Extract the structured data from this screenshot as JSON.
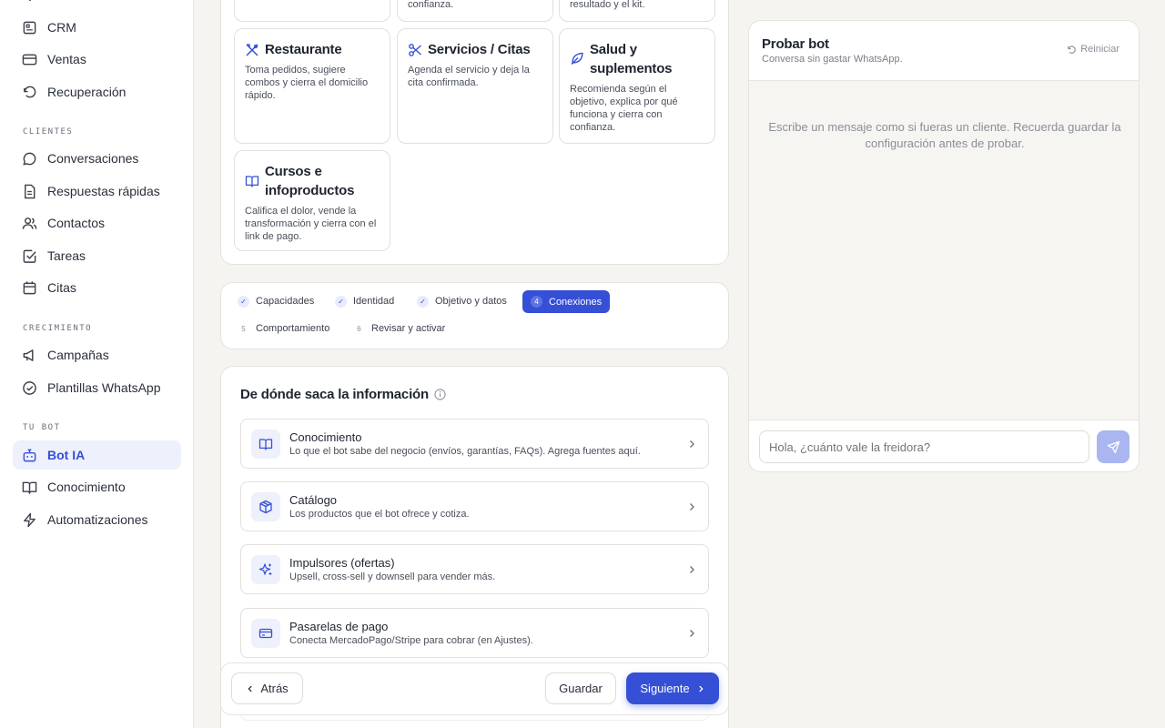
{
  "sidebar": {
    "items_top": [
      {
        "label": "CRM",
        "icon": "crm-icon"
      },
      {
        "label": "Ventas",
        "icon": "credit-card-icon"
      },
      {
        "label": "Recuperación",
        "icon": "rotate-icon"
      }
    ],
    "sections": [
      {
        "label": "CLIENTES",
        "items": [
          "Conversaciones",
          "Respuestas rápidas",
          "Contactos",
          "Tareas",
          "Citas"
        ]
      },
      {
        "label": "CRECIMIENTO",
        "items": [
          "Campañas",
          "Plantillas WhatsApp"
        ]
      },
      {
        "label": "TU BOT",
        "items": [
          "Bot IA",
          "Conocimiento",
          "Automatizaciones"
        ]
      }
    ],
    "active": "Bot IA"
  },
  "verticals": {
    "top_cut": [
      {
        "desc_tail": "confianza."
      },
      {
        "desc_tail": "resultado y el kit."
      }
    ],
    "cards": [
      {
        "title": "Restaurante",
        "desc": "Toma pedidos, sugiere combos y cierra el domicilio rápido.",
        "icon": "scissors-fork-icon"
      },
      {
        "title": "Servicios / Citas",
        "desc": "Agenda el servicio y deja la cita confirmada.",
        "icon": "scissors-icon"
      },
      {
        "title": "Salud y suplementos",
        "desc": "Recomienda según el objetivo, explica por qué funciona y cierra con confianza.",
        "icon": "leaf-icon"
      },
      {
        "title": "Cursos e infoproductos",
        "desc": "Califica el dolor, vende la transformación y cierra con el link de pago.",
        "icon": "book-icon"
      }
    ]
  },
  "stepper": {
    "steps": [
      {
        "label": "Capacidades",
        "state": "done",
        "mark": "✓"
      },
      {
        "label": "Identidad",
        "state": "done",
        "mark": "✓"
      },
      {
        "label": "Objetivo y datos",
        "state": "done",
        "mark": "✓"
      },
      {
        "label": "Conexiones",
        "state": "current",
        "mark": "4"
      },
      {
        "label": "Comportamiento",
        "state": "pending",
        "mark": "5"
      },
      {
        "label": "Revisar y activar",
        "state": "pending",
        "mark": "6"
      }
    ]
  },
  "connections": {
    "title": "De dónde saca la información",
    "items": [
      {
        "title": "Conocimiento",
        "desc": "Lo que el bot sabe del negocio (envíos, garantías, FAQs). Agrega fuentes aquí.",
        "icon": "book-icon"
      },
      {
        "title": "Catálogo",
        "desc": "Los productos que el bot ofrece y cotiza.",
        "icon": "box-icon"
      },
      {
        "title": "Impulsores (ofertas)",
        "desc": "Upsell, cross-sell y downsell para vender más.",
        "icon": "sparkles-icon"
      },
      {
        "title": "Pasarelas de pago",
        "desc": "Conecta MercadoPago/Stripe para cobrar (en Ajustes).",
        "icon": "credit-card-icon"
      }
    ]
  },
  "footer": {
    "back_label": "Atrás",
    "save_label": "Guardar",
    "next_label": "Siguiente"
  },
  "test_bot": {
    "title": "Probar bot",
    "subtitle": "Conversa sin gastar WhatsApp.",
    "reset_label": "Reiniciar",
    "empty_message": "Escribe un mensaje como si fueras un cliente. Recuerda guardar la configuración antes de probar.",
    "input_placeholder": "Hola, ¿cuánto vale la freidora?"
  },
  "colors": {
    "accent": "#3550d6",
    "background": "#f5f4f0",
    "surface": "#ffffff"
  }
}
